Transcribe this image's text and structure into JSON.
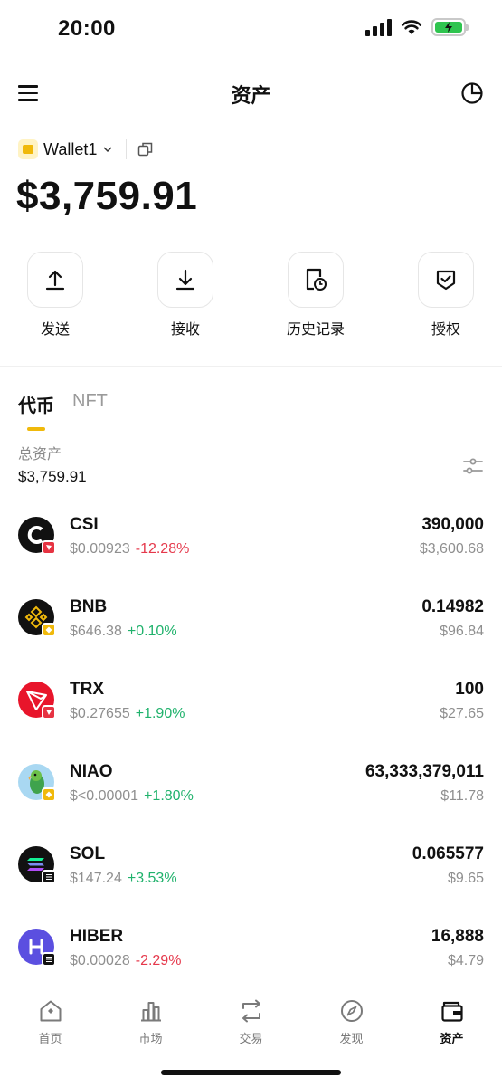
{
  "status": {
    "time": "20:00"
  },
  "header": {
    "title": "资产"
  },
  "wallet": {
    "name": "Wallet1",
    "balance": "$3,759.91"
  },
  "actions": [
    {
      "label": "发送",
      "icon": "upload-icon"
    },
    {
      "label": "接收",
      "icon": "download-icon"
    },
    {
      "label": "历史记录",
      "icon": "history-icon"
    },
    {
      "label": "授权",
      "icon": "shield-check-icon"
    }
  ],
  "tabs": {
    "active": "代币",
    "other": "NFT"
  },
  "total": {
    "label": "总资产",
    "value": "$3,759.91"
  },
  "tokens": [
    {
      "symbol": "CSI",
      "price": "$0.00923",
      "change": "-12.28%",
      "quantity": "390,000",
      "value": "$3,600.68",
      "logo_bg": "#111111",
      "chain_color": "#e63342",
      "change_color": "#e5384b"
    },
    {
      "symbol": "BNB",
      "price": "$646.38",
      "change": "+0.10%",
      "quantity": "0.14982",
      "value": "$96.84",
      "logo_bg": "#111111",
      "chain_color": "#f0b90b",
      "change_color": "#20b26c"
    },
    {
      "symbol": "TRX",
      "price": "$0.27655",
      "change": "+1.90%",
      "quantity": "100",
      "value": "$27.65",
      "logo_bg": "#e8152b",
      "chain_color": "#e63342",
      "change_color": "#20b26c"
    },
    {
      "symbol": "NIAO",
      "price": "$<0.00001",
      "change": "+1.80%",
      "quantity": "63,333,379,011",
      "value": "$11.78",
      "logo_bg": "#9fd4f0",
      "chain_color": "#f0b90b",
      "change_color": "#20b26c"
    },
    {
      "symbol": "SOL",
      "price": "$147.24",
      "change": "+3.53%",
      "quantity": "0.065577",
      "value": "$9.65",
      "logo_bg": "#111111",
      "chain_color": "#111111",
      "change_color": "#20b26c"
    },
    {
      "symbol": "HIBER",
      "price": "$0.00028",
      "change": "-2.29%",
      "quantity": "16,888",
      "value": "$4.79",
      "logo_bg": "#5b4fe0",
      "chain_color": "#111111",
      "change_color": "#e5384b"
    }
  ],
  "tabbar": [
    {
      "label": "首页",
      "icon": "home-icon"
    },
    {
      "label": "市场",
      "icon": "market-icon"
    },
    {
      "label": "交易",
      "icon": "swap-icon"
    },
    {
      "label": "发现",
      "icon": "compass-icon"
    },
    {
      "label": "资产",
      "icon": "wallet-icon",
      "active": true
    }
  ],
  "colors": {
    "accent": "#f0b90b",
    "positive": "#20b26c",
    "negative": "#e5384b"
  }
}
